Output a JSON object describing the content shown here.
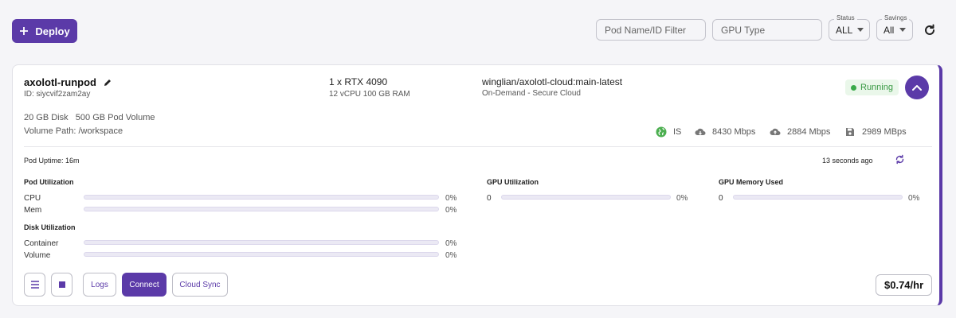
{
  "toolbar": {
    "deploy_label": "Deploy",
    "pod_filter_placeholder": "Pod Name/ID Filter",
    "gpu_type_placeholder": "GPU Type",
    "status": {
      "legend": "Status",
      "value": "ALL"
    },
    "savings": {
      "legend": "Savings",
      "value": "All"
    }
  },
  "pod": {
    "name": "axolotl-runpod",
    "id": "ID: siycvif2zam2ay",
    "gpu": "1 x RTX 4090",
    "specs": "12 vCPU 100 GB RAM",
    "image": "winglian/axolotl-cloud:main-latest",
    "cloud": "On-Demand - Secure Cloud",
    "status": "Running",
    "disk": "20 GB Disk   500 GB Pod Volume",
    "volume_path": "Volume Path: /workspace",
    "stats": {
      "region": "IS",
      "download": "8430 Mbps",
      "upload": "2884 Mbps",
      "disk_speed": "2989 MBps"
    },
    "uptime": "Pod Uptime: 16m",
    "updated": "13 seconds ago",
    "pod_utilization": {
      "title": "Pod Utilization",
      "rows": [
        {
          "label": "CPU",
          "value": "0%",
          "fraction": 0
        },
        {
          "label": "Mem",
          "value": "0%",
          "fraction": 0
        }
      ]
    },
    "disk_utilization": {
      "title": "Disk Utilization",
      "rows": [
        {
          "label": "Container",
          "value": "0%",
          "fraction": 0
        },
        {
          "label": "Volume",
          "value": "0%",
          "fraction": 0
        }
      ]
    },
    "gpu_utilization": {
      "title": "GPU Utilization",
      "index": "0",
      "value": "0%",
      "fraction": 0
    },
    "gpu_memory": {
      "title": "GPU Memory Used",
      "index": "0",
      "value": "0%",
      "fraction": 0
    },
    "buttons": {
      "logs": "Logs",
      "connect": "Connect",
      "cloud_sync": "Cloud Sync"
    },
    "price": "$0.74/hr"
  },
  "colors": {
    "accent": "#5b3aa8",
    "running": "#3aaa4a"
  }
}
